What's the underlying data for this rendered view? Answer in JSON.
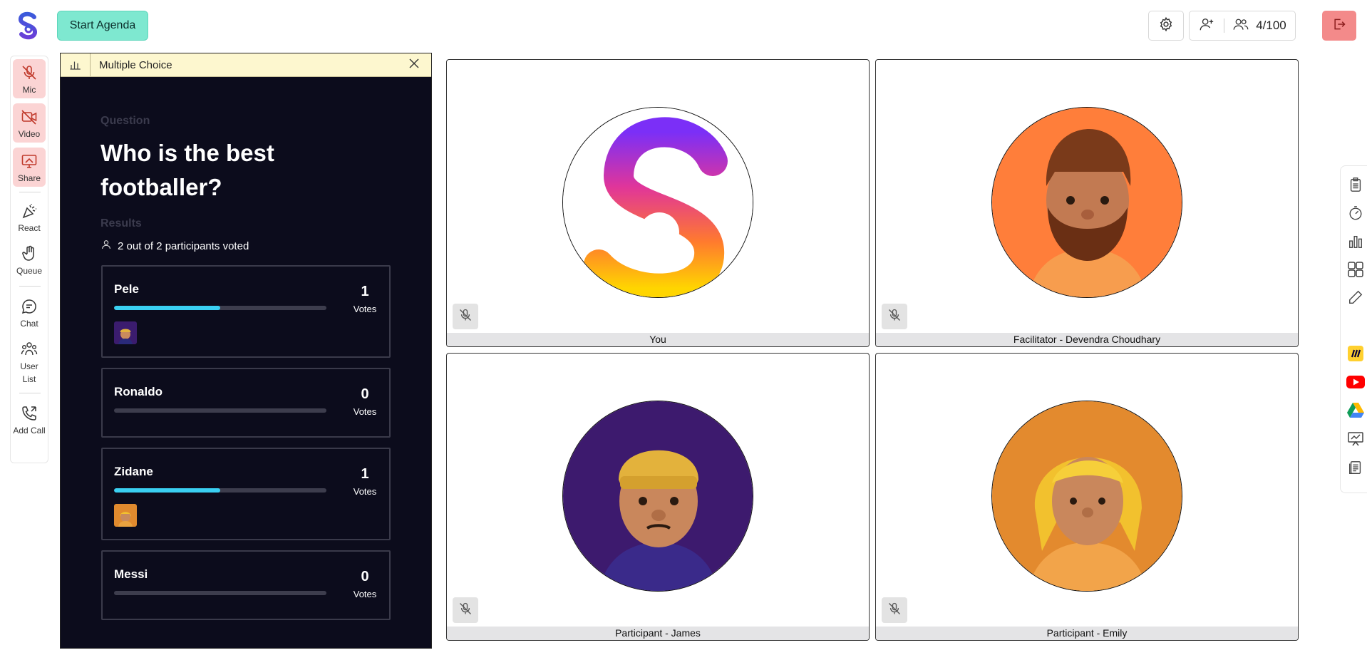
{
  "header": {
    "start_agenda": "Start Agenda",
    "participant_count": "4/100"
  },
  "left_toolbar": {
    "mic": "Mic",
    "video": "Video",
    "share": "Share",
    "react": "React",
    "queue": "Queue",
    "chat": "Chat",
    "user_list": "User List",
    "add_call": "Add Call"
  },
  "poll": {
    "header_title": "Multiple Choice",
    "question_label": "Question",
    "question": "Who is the best footballer?",
    "results_label": "Results",
    "voted_text": "2 out of 2 participants voted",
    "options": [
      {
        "name": "Pele",
        "count": "1",
        "votes_label": "Votes",
        "fraction": 0.5
      },
      {
        "name": "Ronaldo",
        "count": "0",
        "votes_label": "Votes",
        "fraction": 0
      },
      {
        "name": "Zidane",
        "count": "1",
        "votes_label": "Votes",
        "fraction": 0.5
      },
      {
        "name": "Messi",
        "count": "0",
        "votes_label": "Votes",
        "fraction": 0
      }
    ]
  },
  "tiles": [
    {
      "label": "You"
    },
    {
      "label": "Facilitator - Devendra Choudhary"
    },
    {
      "label": "Participant - James"
    },
    {
      "label": "Participant - Emily"
    }
  ],
  "colors": {
    "accent_teal": "#7ee8d0",
    "leave_red": "#f38a8a",
    "panel_dark": "#0c0c1c",
    "bar_fill": "#3ad0f2"
  }
}
